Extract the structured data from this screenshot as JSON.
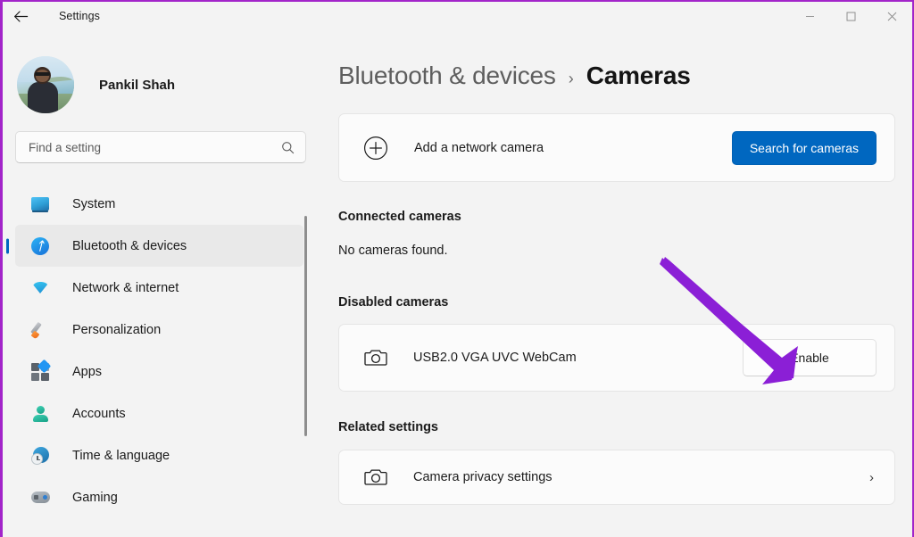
{
  "window": {
    "title": "Settings",
    "back_icon": "back-arrow-icon",
    "minimize_label": "—",
    "maximize_label": "☐",
    "close_label": "✕"
  },
  "sidebar": {
    "profile": {
      "name": "Pankil Shah",
      "avatar": "user-avatar"
    },
    "search": {
      "placeholder": "Find a setting",
      "icon": "search-icon"
    },
    "items": [
      {
        "label": "System",
        "icon": "monitor-icon",
        "selected": false
      },
      {
        "label": "Bluetooth & devices",
        "icon": "bluetooth-icon",
        "selected": true
      },
      {
        "label": "Network & internet",
        "icon": "wifi-icon",
        "selected": false
      },
      {
        "label": "Personalization",
        "icon": "paintbrush-icon",
        "selected": false
      },
      {
        "label": "Apps",
        "icon": "apps-grid-icon",
        "selected": false
      },
      {
        "label": "Accounts",
        "icon": "person-icon",
        "selected": false
      },
      {
        "label": "Time & language",
        "icon": "clock-globe-icon",
        "selected": false
      },
      {
        "label": "Gaming",
        "icon": "gamepad-icon",
        "selected": false
      }
    ]
  },
  "main": {
    "breadcrumb": {
      "parent": "Bluetooth & devices",
      "separator": "›",
      "current": "Cameras"
    },
    "add_camera_card": {
      "icon": "plus-circle-icon",
      "label": "Add a network camera",
      "button": "Search for cameras"
    },
    "connected": {
      "heading": "Connected cameras",
      "empty_text": "No cameras found."
    },
    "disabled": {
      "heading": "Disabled cameras",
      "device": {
        "icon": "camera-icon",
        "name": "USB2.0 VGA UVC WebCam",
        "button": "Enable"
      }
    },
    "related": {
      "heading": "Related settings",
      "item": {
        "icon": "camera-icon",
        "label": "Camera privacy settings",
        "chevron": "›"
      }
    }
  },
  "annotation": {
    "type": "arrow",
    "color": "#8B1FD6",
    "points_to": "Enable"
  },
  "colors": {
    "accent": "#0067C0",
    "selected_bar": "#0067C0",
    "page_bg": "#F3F3F3",
    "card_bg": "#FBFBFB",
    "frame_border": "#A224C9"
  }
}
